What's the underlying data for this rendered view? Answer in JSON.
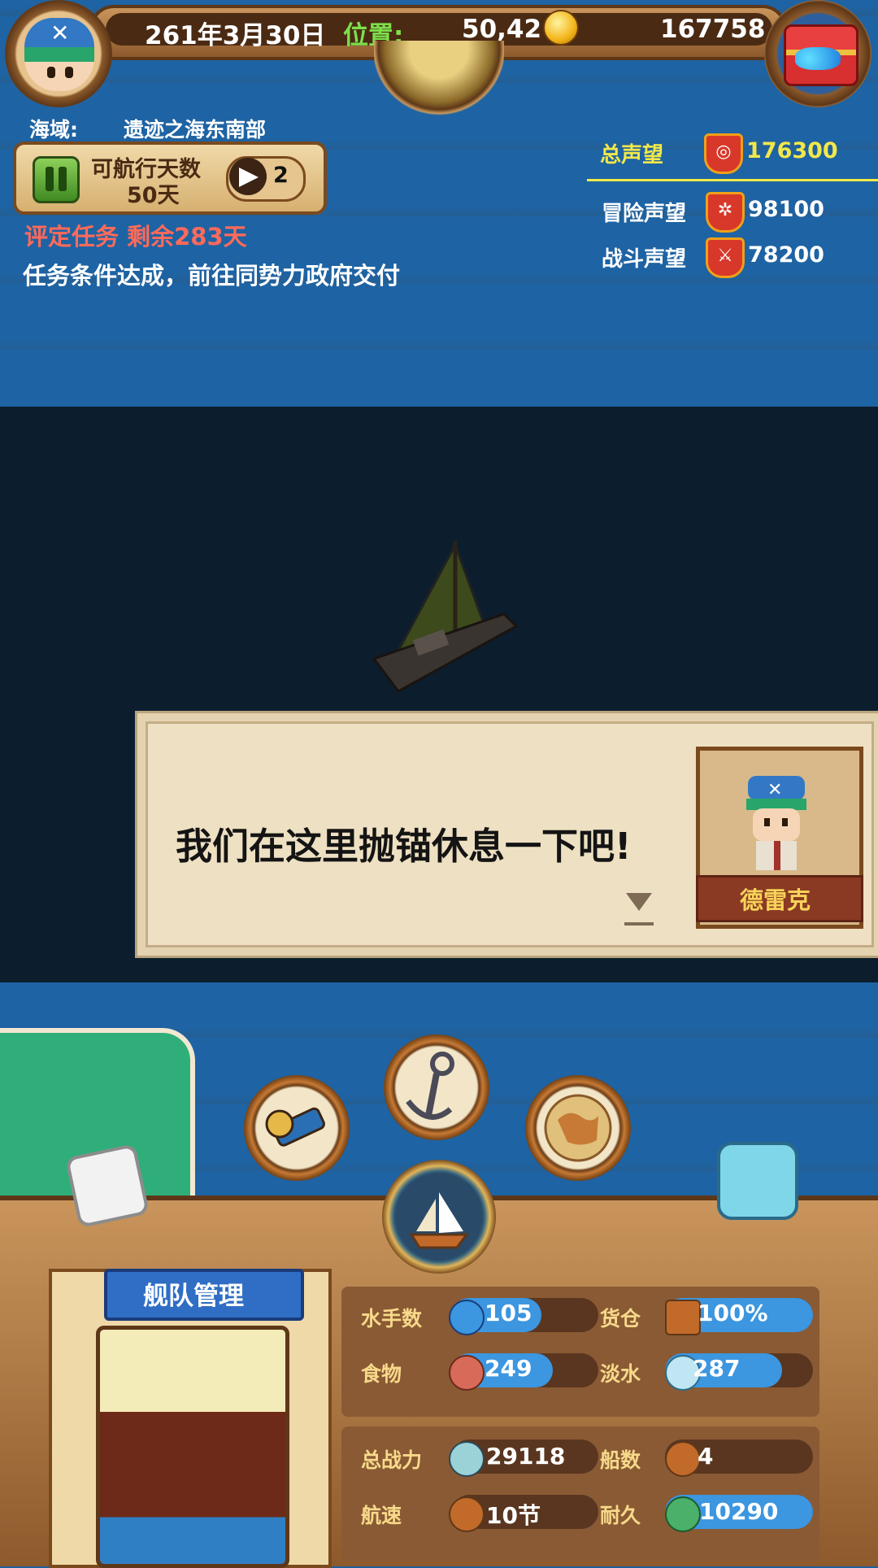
{
  "hud": {
    "date": "261年3月30日",
    "position_label": "位置:",
    "position_value": "50,42",
    "gold": "167758"
  },
  "region": {
    "label": "海域:",
    "value": "遗迹之海东南部"
  },
  "sail": {
    "days_label": "可航行天数",
    "days_value": "50天",
    "speed": "2"
  },
  "task": {
    "title": "评定任务  剩余283天",
    "description": "任务条件达成，前往同势力政府交付"
  },
  "reputation": {
    "total_label": "总声望",
    "total_value": "176300",
    "adventure_label": "冒险声望",
    "adventure_value": "98100",
    "battle_label": "战斗声望",
    "battle_value": "78200"
  },
  "dialog": {
    "text": "我们在这里抛锚休息一下吧!",
    "speaker": "德雷克"
  },
  "fleet": {
    "title": "舰队管理"
  },
  "stats": {
    "sailors_label": "水手数",
    "sailors_value": "105",
    "cargo_label": "货仓",
    "cargo_value": "100%",
    "food_label": "食物",
    "food_value": "249",
    "water_label": "淡水",
    "water_value": "287",
    "power_label": "总战力",
    "power_value": "29118",
    "ships_label": "船数",
    "ships_value": "4",
    "speed_label": "航速",
    "speed_value": "10节",
    "durability_label": "耐久",
    "durability_value": "10290"
  },
  "icons": [
    "avatar-icon",
    "treasure-chest-icon",
    "coin-icon",
    "globe-icon",
    "pause-icon",
    "speed-arrow-icon",
    "spyglass-icon",
    "anchor-icon",
    "world-map-icon",
    "ship-icon",
    "sailor-icon",
    "cargo-crate-icon",
    "meat-icon",
    "water-jug-icon",
    "crossed-swords-icon",
    "fleet-ships-icon",
    "sailboat-icon",
    "hull-icon"
  ],
  "colors": {
    "sea": "#1e63a3",
    "night_sea": "#0c1d2e",
    "wood": "#8e5a2c",
    "accent_yellow": "#f2e84a",
    "task_red": "#ff6a5a",
    "stat_blue": "#3c96e0"
  }
}
